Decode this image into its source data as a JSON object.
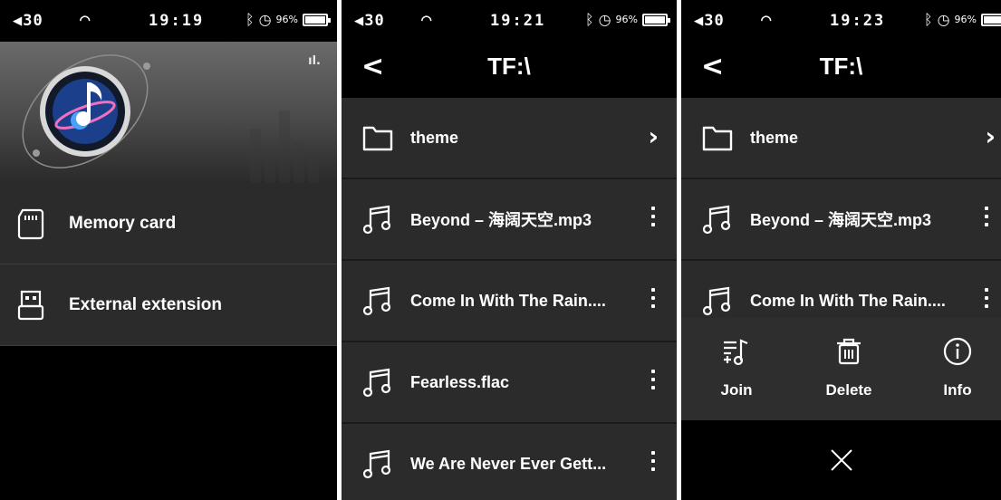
{
  "status": {
    "s1": {
      "volume": "◀30",
      "time": "19:19",
      "battery": "96%"
    },
    "s2": {
      "volume": "◀30",
      "time": "19:21",
      "battery": "96%"
    },
    "s3": {
      "volume": "◀30",
      "time": "19:23",
      "battery": "96%"
    }
  },
  "home": {
    "signal_text": "ıl.",
    "menu": [
      {
        "label": "Memory card",
        "icon": "sd-card-icon"
      },
      {
        "label": "External extension",
        "icon": "usb-drive-icon"
      }
    ]
  },
  "browser": {
    "back_label": "<",
    "path": "TF:\\",
    "folder": "theme",
    "files": [
      "Beyond – 海阔天空.mp3",
      "Come In With The Rain....",
      "Fearless.flac",
      "We Are Never Ever Gett..."
    ]
  },
  "context_menu": {
    "actions": [
      {
        "label": "Join",
        "icon": "playlist-add-icon"
      },
      {
        "label": "Delete",
        "icon": "trash-icon"
      },
      {
        "label": "Info",
        "icon": "info-icon"
      }
    ],
    "close_icon": "close-icon"
  },
  "colors": {
    "row_bg": "#2b2b2b",
    "background": "#000000",
    "accent_blue": "#1a6fd4"
  }
}
